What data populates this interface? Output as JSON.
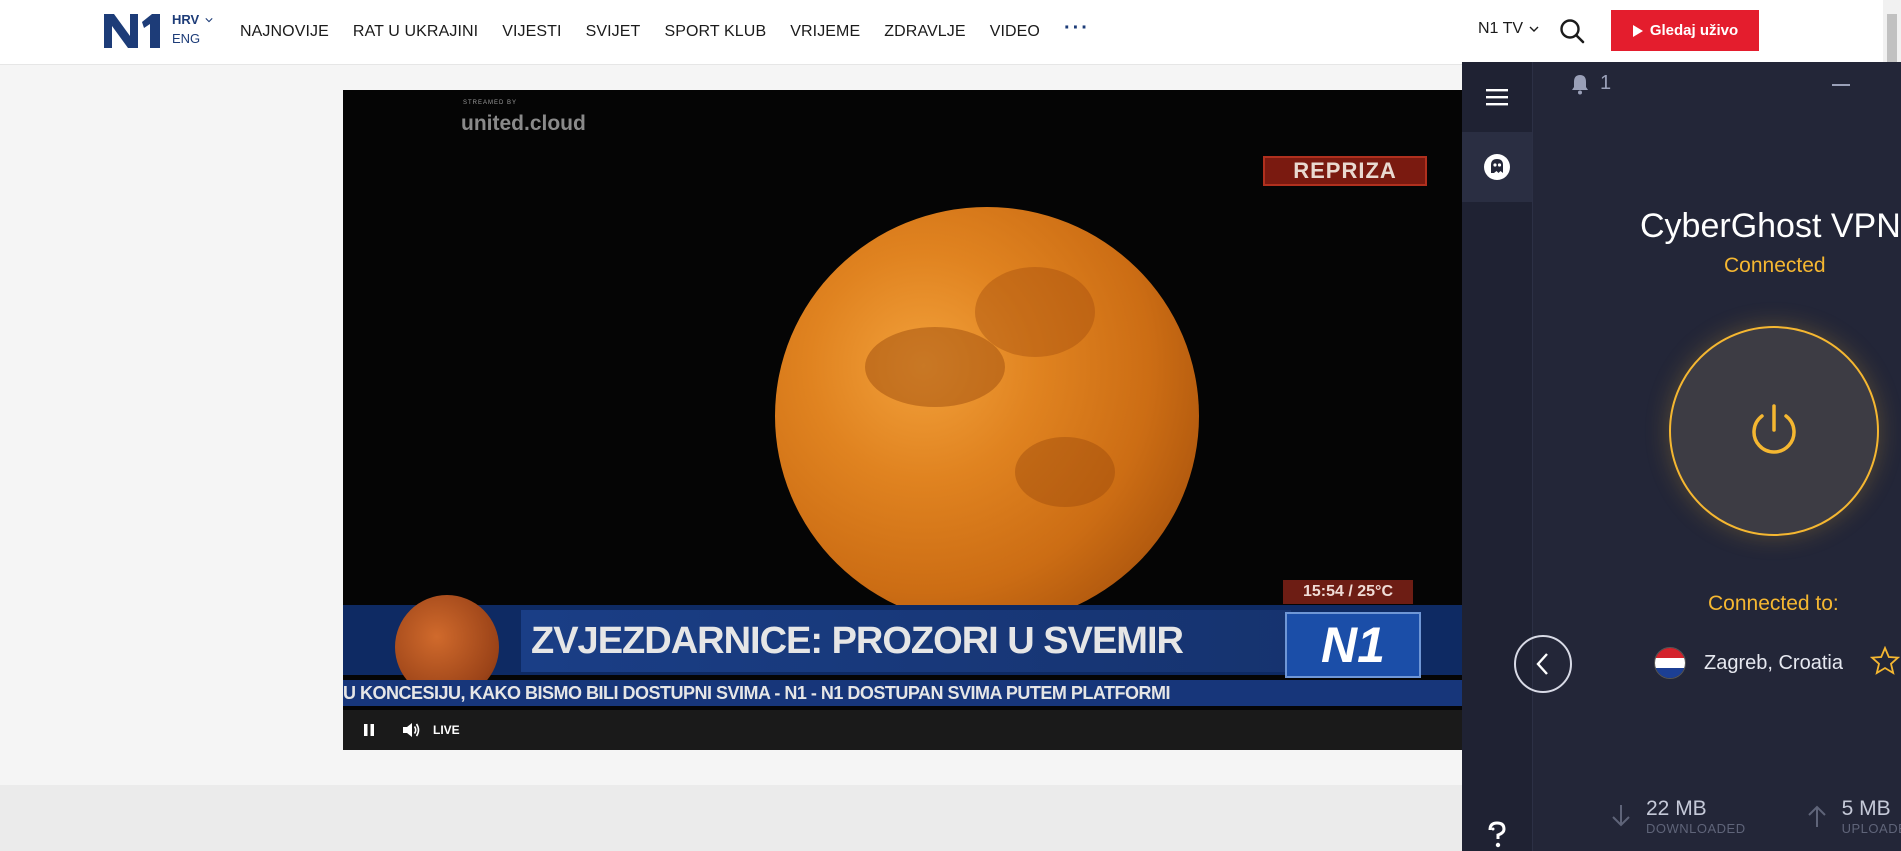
{
  "header": {
    "logo_text": "N1",
    "lang_primary": "HRV",
    "lang_secondary": "ENG",
    "nav": [
      "NAJNOVIJE",
      "RAT U UKRAJINI",
      "VIJESTI",
      "SVIJET",
      "SPORT KLUB",
      "VRIJEME",
      "ZDRAVLJE",
      "VIDEO"
    ],
    "more": "···",
    "n1tv": "N1 TV",
    "live_button": "Gledaj uživo"
  },
  "video": {
    "streamed_by": "STREAMED BY",
    "brand": "united.cloud",
    "repriza": "REPRIZA",
    "time_weather": "15:54 / 25°C",
    "lower_title": "ZVJEZDARNICE: PROZORI U SVEMIR",
    "channel_logo": "N1",
    "ticker": "U KONCESIJU, KAKO BISMO BILI DOSTUPNI SVIMA - N1 - N1 DOSTUPAN SVIMA PUTEM PLATFORMI",
    "live_label": "LIVE"
  },
  "vpn": {
    "notifications": "1",
    "title": "CyberGhost VPN",
    "status": "Connected",
    "connected_to_label": "Connected to:",
    "location": "Zagreb, Croatia",
    "downloaded_value": "22 MB",
    "downloaded_label": "DOWNLOADED",
    "uploaded_value": "5 MB",
    "uploaded_label": "UPLOADED",
    "accent_color": "#f5b731"
  },
  "icons": {
    "search": "search-icon",
    "chevron": "chevron-down-icon",
    "menu": "hamburger-menu-icon",
    "ghost": "ghost-icon",
    "bell": "bell-icon",
    "power": "power-icon",
    "back": "chevron-left-icon",
    "star": "star-icon",
    "download": "arrow-down-icon",
    "upload": "arrow-up-icon",
    "help": "help-icon",
    "pause": "pause-icon",
    "volume": "volume-icon",
    "play": "play-icon"
  }
}
